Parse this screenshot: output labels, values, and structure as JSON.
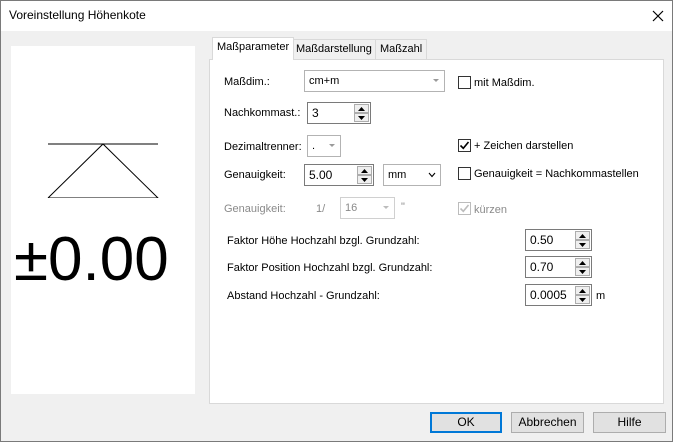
{
  "window": {
    "title": "Voreinstellung Höhenkote"
  },
  "preview": {
    "value_text": "±0.00"
  },
  "tabs": [
    {
      "label": "Maßparameter"
    },
    {
      "label": "Maßdarstellung"
    },
    {
      "label": "Maßzahl"
    }
  ],
  "form": {
    "massdim_label": "Maßdim.:",
    "massdim_value": "cm+m",
    "mit_massdim_label": "mit Maßdim.",
    "nachkommast_label": "Nachkommast.:",
    "nachkommast_value": "3",
    "dezimaltrenner_label": "Dezimaltrenner:",
    "dezimaltrenner_value": ".",
    "zeichen_label": "+ Zeichen darstellen",
    "genauigkeit_label": "Genauigkeit:",
    "genauigkeit_value": "5.00",
    "genauigkeit_unit": "mm",
    "genauigkeit_nk_label": "Genauigkeit = Nachkommastellen",
    "genauigkeit2_label": "Genauigkeit:",
    "genauigkeit2_prefix": "1/",
    "genauigkeit2_value": "16",
    "genauigkeit2_suffix": "\"",
    "kuerzen_label": "kürzen",
    "faktor_hoehe_label": "Faktor Höhe Hochzahl bzgl. Grundzahl:",
    "faktor_hoehe_value": "0.50",
    "faktor_position_label": "Faktor Position Hochzahl bzgl. Grundzahl:",
    "faktor_position_value": "0.70",
    "abstand_label": "Abstand Hochzahl - Grundzahl:",
    "abstand_value": "0.0005",
    "abstand_unit": "m"
  },
  "checkboxes": {
    "mit_massdim": false,
    "zeichen_darstellen": true,
    "genauigkeit_nachkommastellen": false,
    "kuerzen": true
  },
  "buttons": {
    "ok": "OK",
    "abbrechen": "Abbrechen",
    "hilfe": "Hilfe"
  },
  "colors": {
    "accent": "#0078d7",
    "disabled_text": "#8a8a8a"
  }
}
